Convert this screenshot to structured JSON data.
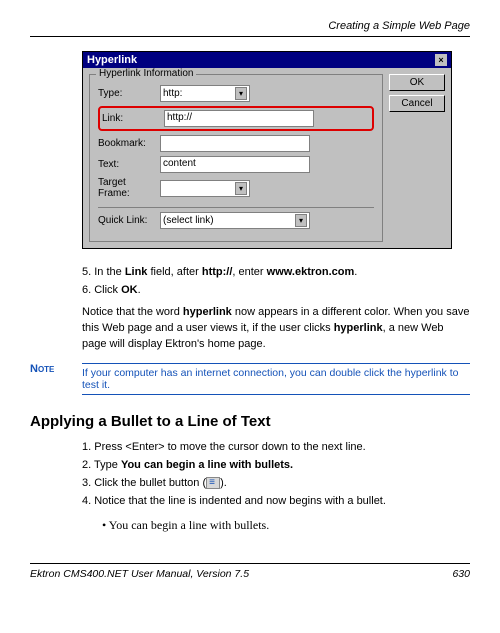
{
  "header": {
    "breadcrumb": "Creating a Simple Web Page"
  },
  "dialog": {
    "title": "Hyperlink",
    "legend": "Hyperlink Information",
    "labels": {
      "type": "Type:",
      "link": "Link:",
      "bookmark": "Bookmark:",
      "text": "Text:",
      "target_frame": "Target Frame:",
      "quick_link": "Quick Link:"
    },
    "values": {
      "type": "http:",
      "link": "http://",
      "bookmark": "",
      "text": "content",
      "target_frame": "",
      "quick_link": "(select link)"
    },
    "buttons": {
      "ok": "OK",
      "cancel": "Cancel"
    }
  },
  "steps1": {
    "s5_pre": "5.   In the ",
    "s5_b1": "Link",
    "s5_mid": " field, after ",
    "s5_b2": "http://",
    "s5_mid2": ", enter ",
    "s5_b3": "www.ektron.com",
    "s5_post": ".",
    "s6_pre": "6.   Click ",
    "s6_b": "OK",
    "s6_post": "."
  },
  "para1": {
    "t1": "Notice that the word ",
    "b1": "hyperlink",
    "t2": " now appears in a different color. When you save this Web page and a user views it, if the user clicks ",
    "b2": "hyperlink",
    "t3": ", a new Web page will display Ektron's home page."
  },
  "note": {
    "label": "Note",
    "text": "If your computer has an internet connection, you can double click the hyperlink to test it."
  },
  "h2": "Applying a Bullet to a Line of Text",
  "steps2": {
    "s1": "1.   Press <Enter> to move the cursor down to the next line.",
    "s2_pre": "2.   Type ",
    "s2_b": "You can begin a line with bullets.",
    "s3_pre": "3.   Click the bullet button (",
    "s3_post": ").",
    "s4": "4.   Notice that the line is indented and now begins with a bullet."
  },
  "example": "You can begin a line with bullets.",
  "footer": {
    "left": "Ektron CMS400.NET User Manual, Version 7.5",
    "right": "630"
  }
}
